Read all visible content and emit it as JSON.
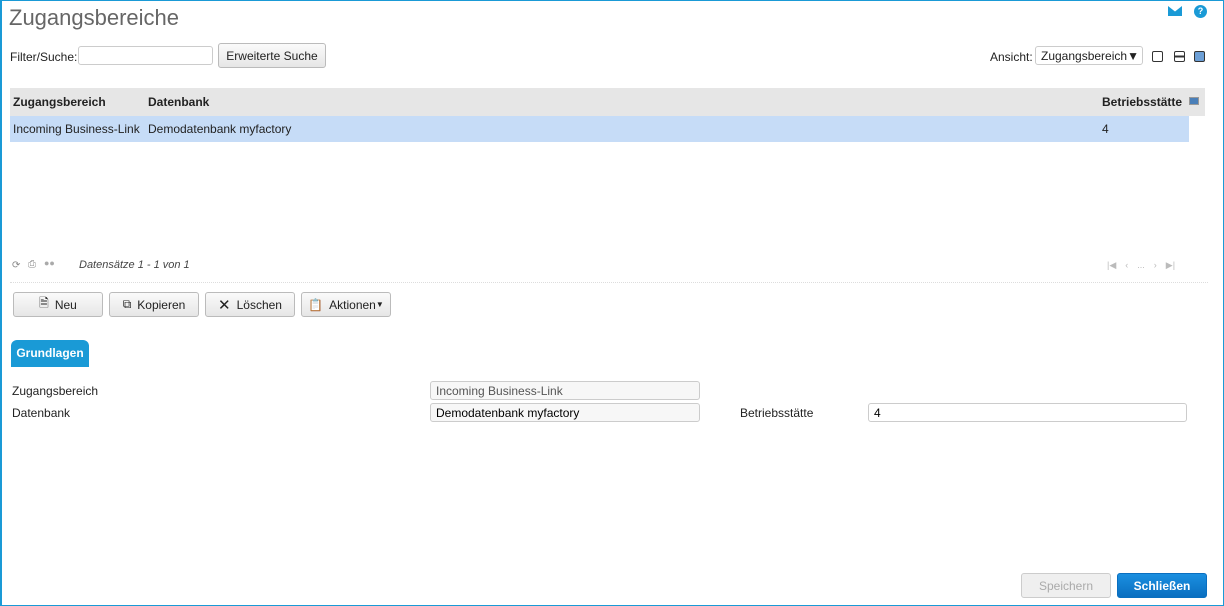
{
  "title": "Zugangsbereiche",
  "filter": {
    "label": "Filter/Suche:",
    "value": "",
    "advanced_button": "Erweiterte Suche"
  },
  "view": {
    "label": "Ansicht:",
    "selected": "Zugangsbereich"
  },
  "grid": {
    "columns": [
      "Zugangsbereich",
      "Datenbank",
      "Betriebsstätte"
    ],
    "rows": [
      {
        "zugangsbereich": "Incoming Business-Link",
        "datenbank": "Demodatenbank myfactory",
        "betriebsstaette": "4"
      }
    ]
  },
  "pager": {
    "records": "Datensätze 1 - 1 von 1",
    "ellipsis": "..."
  },
  "toolbar": {
    "new": "Neu",
    "copy": "Kopieren",
    "delete": "Löschen",
    "actions": "Aktionen"
  },
  "tabs": [
    {
      "label": "Grundlagen",
      "active": true
    }
  ],
  "form": {
    "zugangsbereich_label": "Zugangsbereich",
    "zugangsbereich_value": "Incoming Business-Link",
    "datenbank_label": "Datenbank",
    "datenbank_value": "Demodatenbank myfactory",
    "betriebsstaette_label": "Betriebsstätte",
    "betriebsstaette_value": "4"
  },
  "footer": {
    "save": "Speichern",
    "close": "Schließen"
  },
  "colors": {
    "accent": "#0a7fd0",
    "selected_row": "#c6dcf7",
    "tab": "#1a9ad6"
  }
}
